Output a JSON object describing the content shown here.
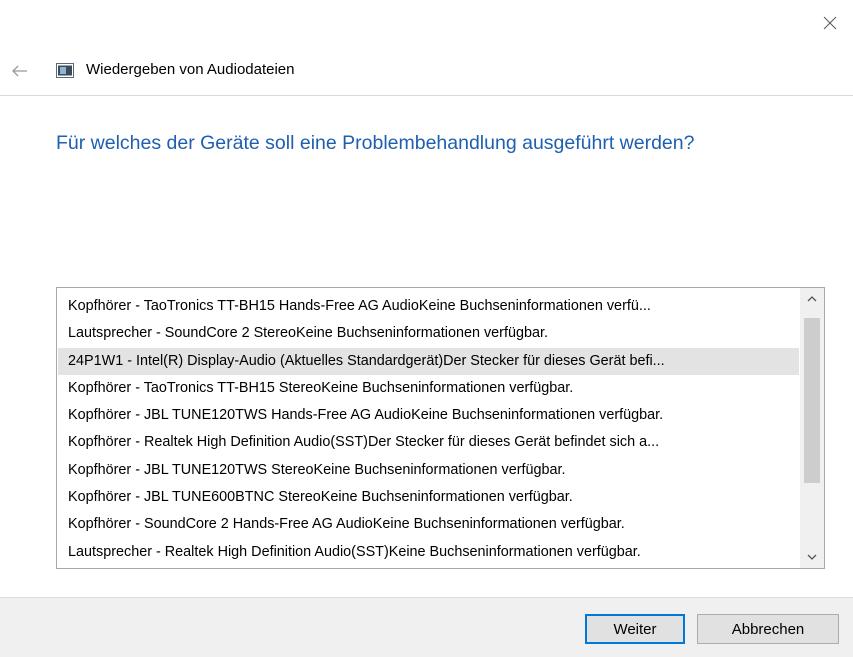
{
  "window": {
    "title": "Wiedergeben von Audiodateien"
  },
  "heading": "Für welches der Geräte soll eine Problembehandlung ausgeführt werden?",
  "devices": [
    "Kopfhörer - TaoTronics TT-BH15 Hands-Free AG AudioKeine Buchseninformationen verfü...",
    "Lautsprecher - SoundCore 2 StereoKeine Buchseninformationen verfügbar.",
    "24P1W1 - Intel(R) Display-Audio (Aktuelles Standardgerät)Der Stecker für dieses Gerät befi...",
    "Kopfhörer - TaoTronics TT-BH15 StereoKeine Buchseninformationen verfügbar.",
    "Kopfhörer - JBL TUNE120TWS Hands-Free AG AudioKeine Buchseninformationen verfügbar.",
    "Kopfhörer - Realtek High Definition Audio(SST)Der Stecker für dieses Gerät befindet sich a...",
    "Kopfhörer - JBL TUNE120TWS StereoKeine Buchseninformationen verfügbar.",
    "Kopfhörer - JBL TUNE600BTNC StereoKeine Buchseninformationen verfügbar.",
    "Kopfhörer - SoundCore 2 Hands-Free AG AudioKeine Buchseninformationen verfügbar.",
    "Lautsprecher - Realtek High Definition Audio(SST)Keine Buchseninformationen verfügbar."
  ],
  "selected_index": 2,
  "buttons": {
    "next": "Weiter",
    "cancel": "Abbrechen"
  },
  "colors": {
    "heading": "#1e5fb0",
    "selection": "#e3e3e3",
    "default_button_border": "#0078d7"
  }
}
